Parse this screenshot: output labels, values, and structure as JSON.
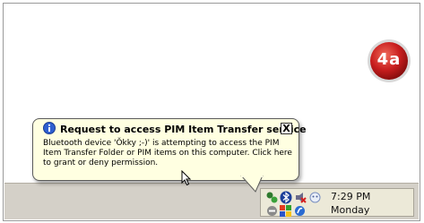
{
  "balloon": {
    "title": "Request to access PIM Item Transfer service",
    "message_line1": "Bluetooth device 'Ŏkky ;-)' is attempting to access the PIM",
    "message_line2": "Item Transfer Folder or PIM items on this computer.  Click here",
    "message_line3": "to grant or deny permission.",
    "close_label": "X",
    "icon": "info-icon"
  },
  "taskbar": {
    "clock_time": "7:29 PM",
    "clock_day": "Monday",
    "tray_icons": [
      "network-icon",
      "bluetooth-icon",
      "speaker-icon",
      "messenger-icon",
      "safely-remove-icon",
      "security-icon",
      "antivirus-icon"
    ]
  },
  "step_badge": {
    "label": "4a",
    "color": "#c81e1e"
  },
  "colors": {
    "balloon_bg": "#ffffe1",
    "taskbar_bg": "#d4d0c8",
    "badge_red": "#c81e1e"
  }
}
